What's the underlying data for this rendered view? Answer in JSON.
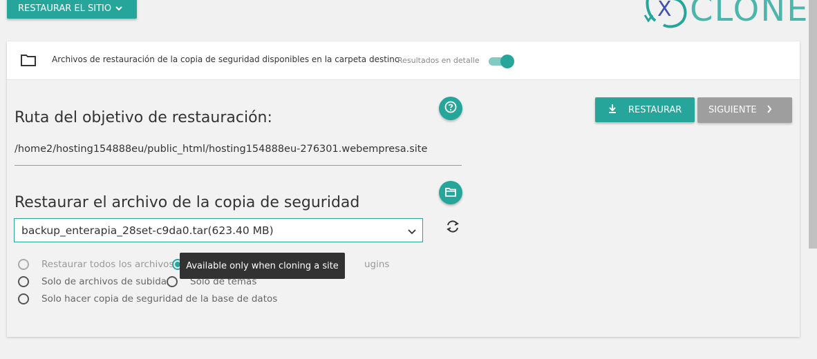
{
  "top_menu": {
    "label": "RESTAURAR EL SITIO",
    "icon": "chevron-down-icon"
  },
  "logo": {
    "text": "CLONER",
    "mark": "X"
  },
  "header": {
    "icon": "folder-icon",
    "text": "Archivos de restauración de la copia de seguridad disponibles en la carpeta destino",
    "detail_label": "Resultados en detalle",
    "detail_toggle_on": true
  },
  "target_path": {
    "title": "Ruta del objetivo de restauración:",
    "value": "/home2/hosting154888eu/public_html/hosting154888eu-276301.webempresa.site",
    "help_icon": "help-icon"
  },
  "backup_file": {
    "title": "Restaurar el archivo de la copia de seguridad",
    "selected": "backup_enterapia_28set-c9da0.tar(623.40 MB)",
    "folder_icon": "folder-open-icon",
    "refresh_icon": "refresh-icon"
  },
  "options": [
    {
      "label": "Restaurar todos los archivos",
      "state": "disabled"
    },
    {
      "label": "ugins",
      "state": "checked"
    },
    {
      "label": "Solo de archivos de subida",
      "state": "unchecked"
    },
    {
      "label": "Solo de temas",
      "state": "unchecked"
    },
    {
      "label": "Solo hacer copia de seguridad de la base de datos",
      "state": "unchecked"
    }
  ],
  "tooltip": "Available only when cloning a site",
  "actions": {
    "restore_label": "RESTAURAR",
    "next_label": "SIGUIENTE"
  },
  "colors": {
    "accent": "#26a69a",
    "accent_light": "#80cbc4",
    "disabled_btn": "#9e9e9e"
  }
}
